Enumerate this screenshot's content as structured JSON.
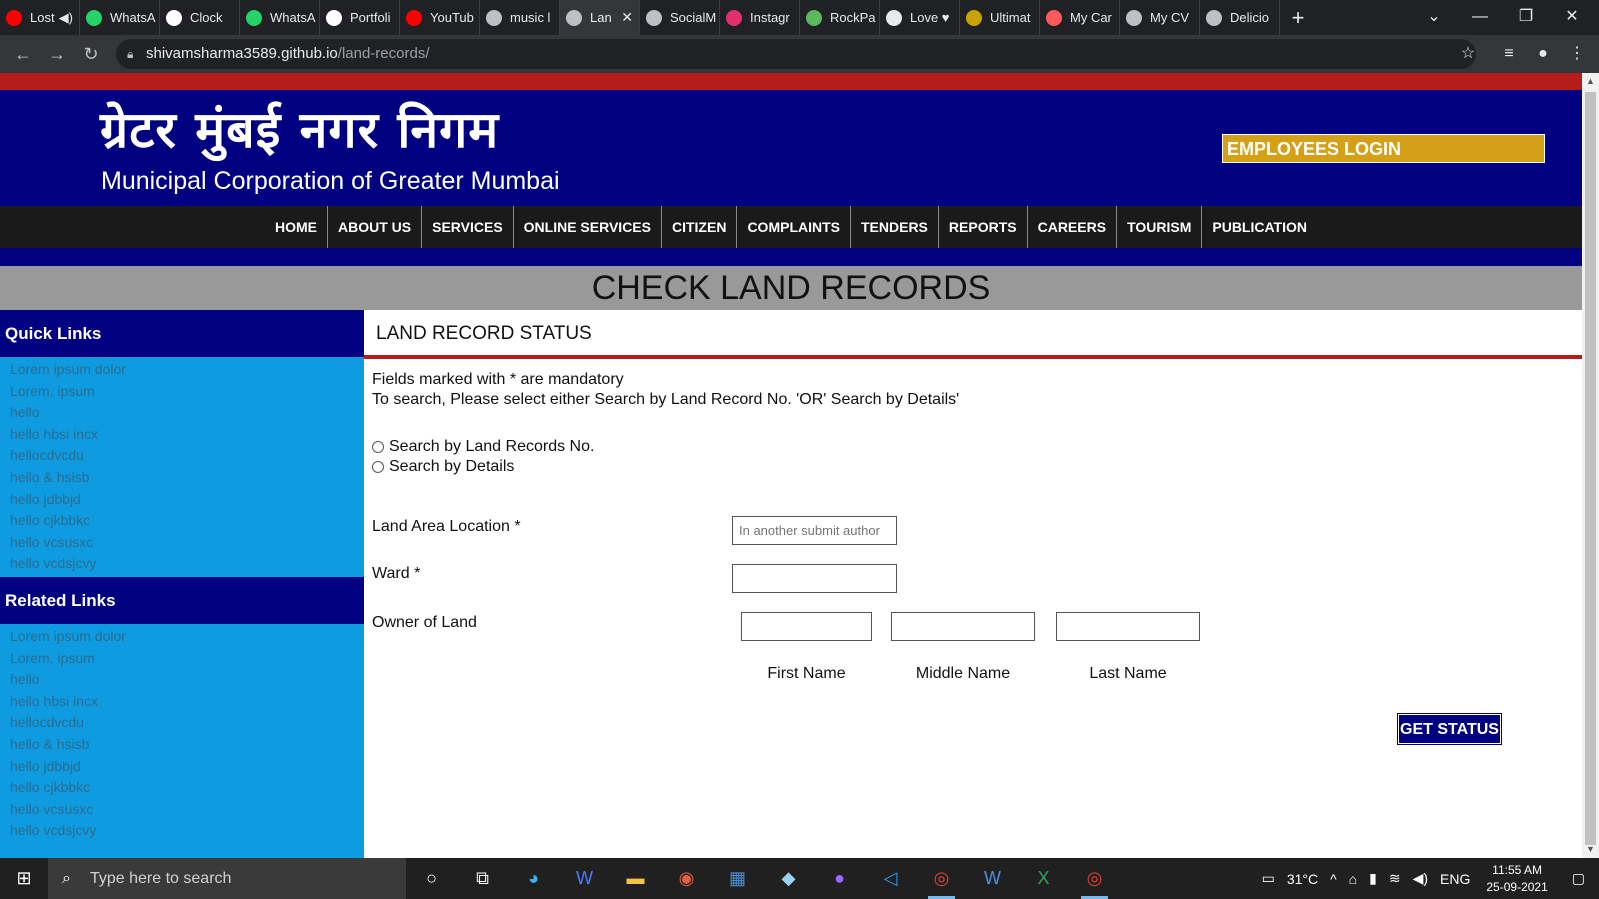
{
  "browser": {
    "tabs": [
      {
        "title": "Lost",
        "icon": "youtube-record-icon",
        "color": "#ff0000",
        "extra": "◀)"
      },
      {
        "title": "WhatsA",
        "icon": "whatsapp-icon",
        "color": "#25d366"
      },
      {
        "title": "Clock",
        "icon": "clock-icon",
        "color": "#ffffff"
      },
      {
        "title": "WhatsA",
        "icon": "whatsapp-icon",
        "color": "#25d366"
      },
      {
        "title": "Portfoli",
        "icon": "s-logo-icon",
        "color": "#ffffff"
      },
      {
        "title": "YouTub",
        "icon": "youtube-icon",
        "color": "#ff0000"
      },
      {
        "title": "music l",
        "icon": "globe-icon",
        "color": "#bdc1c6"
      },
      {
        "title": "Lan",
        "icon": "globe-icon",
        "color": "#bdc1c6",
        "active": true
      },
      {
        "title": "SocialM",
        "icon": "globe-icon",
        "color": "#bdc1c6"
      },
      {
        "title": "Instagr",
        "icon": "instagram-icon",
        "color": "#e1306c"
      },
      {
        "title": "RockPa",
        "icon": "rockpaper-icon",
        "color": "#5cb85c"
      },
      {
        "title": "Love ♥",
        "icon": "love-icon",
        "color": "#e8eaed"
      },
      {
        "title": "Ultimat",
        "icon": "ultimate-icon",
        "color": "#c8a400"
      },
      {
        "title": "My Car",
        "icon": "car-icon",
        "color": "#ff5a5a"
      },
      {
        "title": "My CV",
        "icon": "globe-icon",
        "color": "#bdc1c6"
      },
      {
        "title": "Delicio",
        "icon": "globe-icon",
        "color": "#bdc1c6"
      }
    ],
    "url_host": "shivamsharma3589.github.io",
    "url_path": "/land-records/"
  },
  "header": {
    "hindi_title": "ग्रेटर मुंबई नगर निगम",
    "english_title": "Municipal Corporation of Greater Mumbai",
    "employees_login": "EMPLOYEES LOGIN"
  },
  "nav": {
    "items": [
      "HOME",
      "ABOUT US",
      "SERVICES",
      "ONLINE SERVICES",
      "CITIZEN",
      "COMPLAINTS",
      "TENDERS",
      "REPORTS",
      "CAREERS",
      "TOURISM",
      "PUBLICATION"
    ]
  },
  "page_title": "CHECK LAND RECORDS",
  "sidebar": {
    "quick_links_title": "Quick Links",
    "quick_links": [
      "Lorem ipsum dolor",
      "Lorem, ipsum",
      "hello",
      "hello hbsi incx",
      "hellocdvcdu",
      "hello & hsisb",
      "hello jdbbjd",
      "hello cjkbbkc",
      "hello vcsusxc",
      "hello vcdsjcvy"
    ],
    "related_links_title": "Related Links",
    "related_links": [
      "Lorem ipsum dolor",
      "Lorem, ipsum",
      "hello",
      "hello hbsi incx",
      "hellocdvcdu",
      "hello & hsisb",
      "hello jdbbjd",
      "hello cjkbbkc",
      "hello vcsusxc",
      "hello vcdsjcvy"
    ]
  },
  "form": {
    "section_title": "LAND RECORD STATUS",
    "mandatory_note": "Fields marked with * are mandatory",
    "search_note": "To search, Please select either Search by Land Record No. 'OR' Search by Details'",
    "radio_by_number": "Search by Land Records No.",
    "radio_by_details": "Search by Details",
    "land_area_label": "Land Area Location *",
    "land_area_placeholder": "In another submit author",
    "ward_label": "Ward *",
    "owner_label": "Owner of Land",
    "first_name_label": "First Name",
    "middle_name_label": "Middle Name",
    "last_name_label": "Last Name",
    "get_status": "GET STATUS"
  },
  "taskbar": {
    "search_placeholder": "Type here to search",
    "temperature": "31°C",
    "language": "ENG",
    "time": "11:55 AM",
    "date": "25-09-2021"
  },
  "colors": {
    "header_blue": "#000080",
    "red_strip": "#b51d1d",
    "login_gold": "#d4a017",
    "sidebar_cyan": "#0f9be0"
  }
}
